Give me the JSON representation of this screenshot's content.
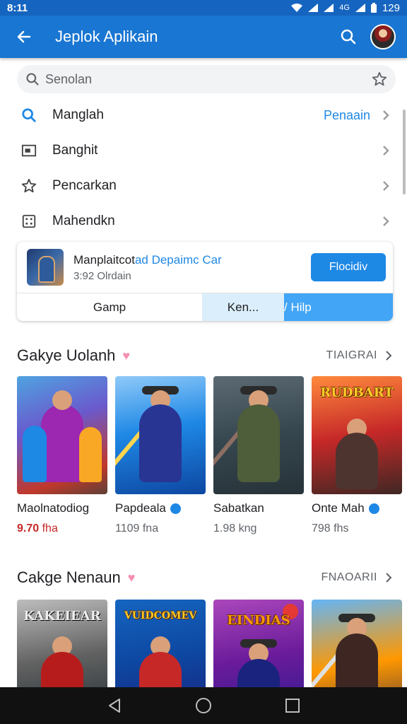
{
  "status": {
    "time": "8:11",
    "network": "4G",
    "battery": "129"
  },
  "app_bar": {
    "title": "Jeplok Aplikain"
  },
  "search": {
    "placeholder": "Senolan"
  },
  "menu": [
    {
      "label": "Manglah",
      "icon": "search-icon",
      "extra": "Penaain"
    },
    {
      "label": "Banghit",
      "icon": "window-icon",
      "extra": ""
    },
    {
      "label": "Pencarkan",
      "icon": "star-icon",
      "extra": ""
    },
    {
      "label": "Mahendkn",
      "icon": "grid-icon",
      "extra": ""
    }
  ],
  "featured_app": {
    "name_black": "Manplaitcot",
    "name_blue": "ad Depaimc Car",
    "sub": "3:92 Olrdain",
    "install_label": "Flocidiv",
    "tabs": [
      "Gamp",
      "Ken...",
      "/ Hilp"
    ]
  },
  "sections": [
    {
      "title": "Gakye Uolanh",
      "more": "TIAIGRAI",
      "games": [
        {
          "name": "Maolnatodiog",
          "meta_num": "9.70",
          "meta_unit": "fha",
          "verified": false,
          "rating_red": true,
          "banner": ""
        },
        {
          "name": "Papdeala",
          "meta_num": "1109",
          "meta_unit": "fna",
          "verified": true,
          "rating_red": false,
          "banner": ""
        },
        {
          "name": "Sabatkan",
          "meta_num": "1.98",
          "meta_unit": "kng",
          "verified": false,
          "rating_red": false,
          "banner": ""
        },
        {
          "name": "Onte Mah",
          "meta_num": "798",
          "meta_unit": "fhs",
          "verified": true,
          "rating_red": false,
          "banner": "RUDBART"
        }
      ]
    },
    {
      "title": "Cakge Nenaun",
      "more": "FNAOARII",
      "games": [
        {
          "banner": "KAKEIEAR"
        },
        {
          "banner": "VUIDCOMEV"
        },
        {
          "banner": "EINDIAS"
        },
        {
          "banner": ""
        }
      ]
    }
  ],
  "colors": {
    "app_bar": "#1976d2",
    "accent": "#1e88e5",
    "rating": "#c62828"
  }
}
